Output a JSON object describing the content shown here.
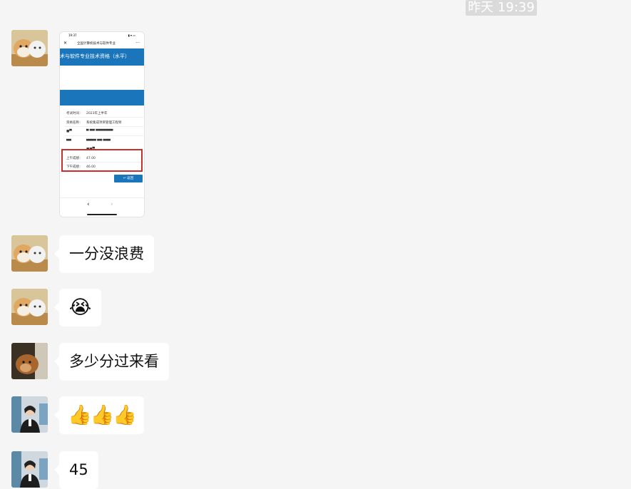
{
  "timestamp": "昨天 19:39",
  "image_message": {
    "status_time": "19:37",
    "status_icons": "▮ ▾ ▭",
    "nav_close": "✕",
    "nav_title": "全国计算机技术与软件专业",
    "nav_more": "···",
    "banner_text": "术与软件专业技术资格（水平）",
    "rows": [
      {
        "key": "考试时间：",
        "value": "2023年上半年"
      },
      {
        "key": "资格名称：",
        "value": "系统集成项目管理工程师"
      },
      {
        "key": "■▀",
        "value": "▀ ▀▀  ▀▀▀▀▀▀▀"
      },
      {
        "key": "▀▀",
        "value": "▀▀▀▀ ▀▀  ▀▀▀"
      },
      {
        "key": "",
        "value": "■■▀"
      },
      {
        "key": "上午成绩：",
        "value": "47.00"
      },
      {
        "key": "下午成绩：",
        "value": "46.00"
      }
    ],
    "back_button": "↩ 返回",
    "nav_back": "‹",
    "nav_forward": "›",
    "highlight_color": "#c9302c",
    "accent_color": "#1a75bb"
  },
  "messages": [
    {
      "text": "一分没浪费"
    },
    {
      "text": "😭"
    },
    {
      "text": "多少分过来看"
    },
    {
      "text": "👍👍👍"
    },
    {
      "text": "45"
    }
  ]
}
